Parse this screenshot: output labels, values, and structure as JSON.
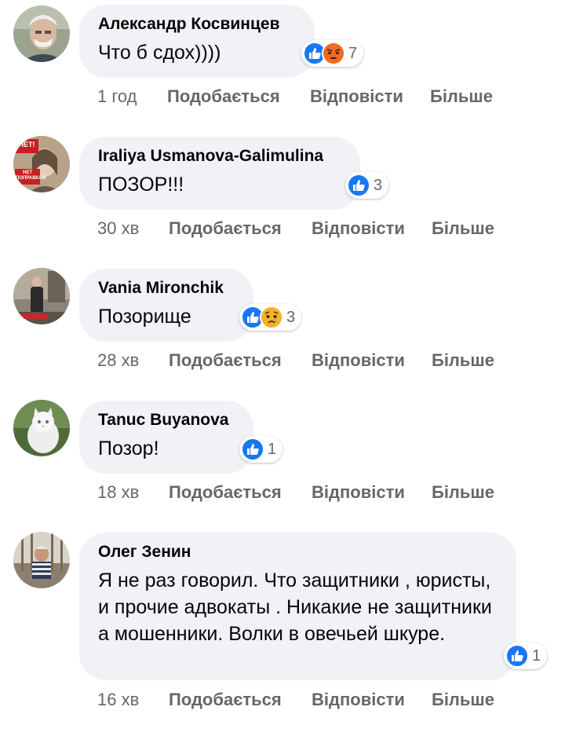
{
  "actions": {
    "like": "Подобається",
    "reply": "Відповісти",
    "more": "Більше"
  },
  "colors": {
    "bubble": "#f0f2f5",
    "meta_text": "#65676b",
    "like_blue": "#1877f2",
    "angry_orange": "#f5731c",
    "sad_yellow": "#f7b125"
  },
  "comments": [
    {
      "author": "Александр Косвинцев",
      "text": "Что б сдох))))",
      "reactions": [
        "like-icon",
        "angry-icon"
      ],
      "reaction_count": "7",
      "time": "1 год"
    },
    {
      "author": "Iraliya Usmanova-Galimulina",
      "text": "ПОЗОР!!!",
      "reactions": [
        "like-icon"
      ],
      "reaction_count": "3",
      "time": "30 хв",
      "avatar_text": [
        "НЕТ!",
        "НЕТ",
        "ПОПРАВКАМ"
      ]
    },
    {
      "author": "Vania Mironchik",
      "text": "Позорище",
      "reactions": [
        "like-icon",
        "sad-icon"
      ],
      "reaction_count": "3",
      "time": "28 хв"
    },
    {
      "author": "Tanuc Buyanova",
      "text": "Позор!",
      "reactions": [
        "like-icon"
      ],
      "reaction_count": "1",
      "time": "18 хв"
    },
    {
      "author": "Олег Зенин",
      "text": "Я не раз говорил. Что защитники , юристы, и прочие адвокаты . Никакие не защитники а мошенники. Волки в овечьей шкуре.",
      "reactions": [
        "like-icon"
      ],
      "reaction_count": "1",
      "time": "16 хв"
    }
  ]
}
